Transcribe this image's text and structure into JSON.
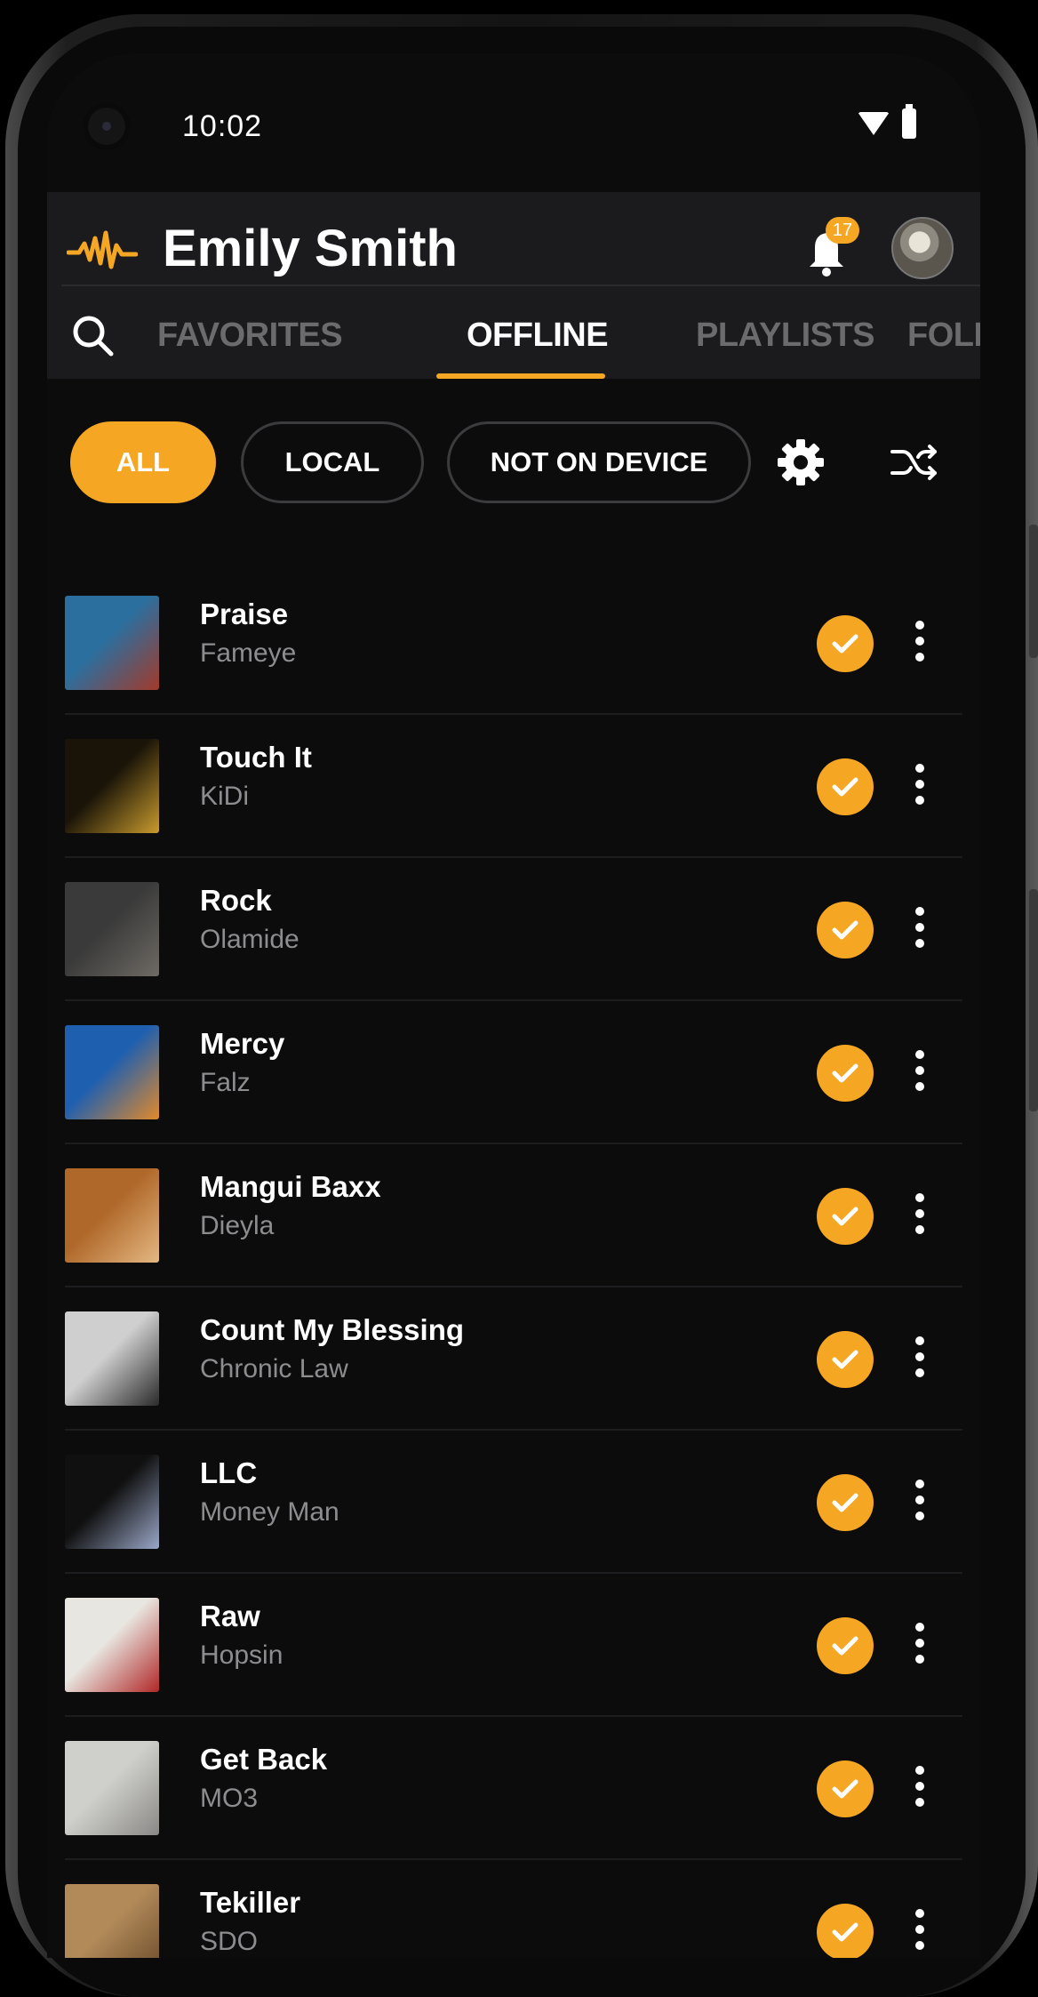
{
  "status_bar": {
    "time": "10:02"
  },
  "header": {
    "user_name": "Emily Smith",
    "notification_count": "17",
    "accent": "#f5a623"
  },
  "tabs": [
    {
      "label": "FAVORITES",
      "active": false
    },
    {
      "label": "OFFLINE",
      "active": true
    },
    {
      "label": "PLAYLISTS",
      "active": false
    },
    {
      "label": "FOLLOWING",
      "active": false
    }
  ],
  "filters": [
    {
      "label": "ALL",
      "active": true
    },
    {
      "label": "LOCAL",
      "active": false
    },
    {
      "label": "NOT ON DEVICE",
      "active": false
    }
  ],
  "icons": {
    "search": "search-icon",
    "settings": "gear-icon",
    "shuffle": "shuffle-icon",
    "notifications": "bell-icon",
    "downloaded": "check-circle-icon",
    "more": "more-vertical-icon"
  },
  "tracks": [
    {
      "title": "Praise",
      "artist": "Fameye",
      "downloaded": true,
      "art": [
        "#2b6f9e",
        "#a23a2a"
      ]
    },
    {
      "title": "Touch It",
      "artist": "KiDi",
      "downloaded": true,
      "art": [
        "#1a1408",
        "#c99b2e"
      ]
    },
    {
      "title": "Rock",
      "artist": "Olamide",
      "downloaded": true,
      "art": [
        "#3a3a3a",
        "#6e6a64"
      ]
    },
    {
      "title": "Mercy",
      "artist": "Falz",
      "downloaded": true,
      "art": [
        "#1e5fb0",
        "#e08a2a"
      ]
    },
    {
      "title": "Mangui Baxx",
      "artist": "Dieyla",
      "downloaded": true,
      "art": [
        "#b0682a",
        "#e4b882"
      ]
    },
    {
      "title": "Count My Blessing",
      "artist": "Chronic Law",
      "downloaded": true,
      "art": [
        "#cfcfcf",
        "#2a2a2a"
      ]
    },
    {
      "title": "LLC",
      "artist": "Money Man",
      "downloaded": true,
      "art": [
        "#101010",
        "#9aa7c8"
      ]
    },
    {
      "title": "Raw",
      "artist": "Hopsin",
      "downloaded": true,
      "art": [
        "#e8e6e0",
        "#b02828"
      ]
    },
    {
      "title": "Get Back",
      "artist": "MO3",
      "downloaded": true,
      "art": [
        "#cfd0cc",
        "#8a8886"
      ]
    },
    {
      "title": "Tekiller",
      "artist": "SDO",
      "downloaded": true,
      "art": [
        "#b28a5a",
        "#6a4a2a"
      ]
    }
  ]
}
